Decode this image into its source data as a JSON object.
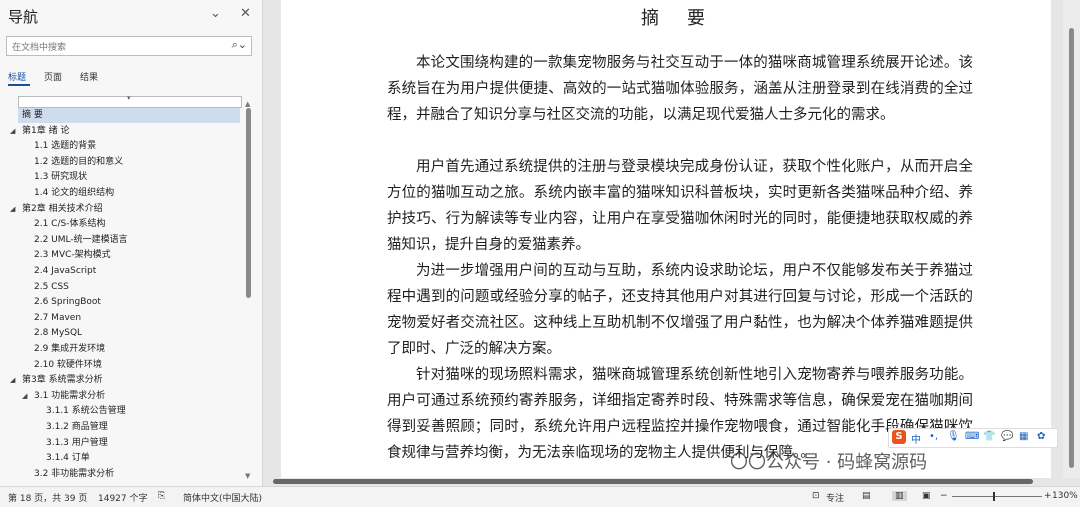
{
  "nav": {
    "title": "导航",
    "search_placeholder": "在文档中搜索",
    "tabs": [
      {
        "label": "标题",
        "active": true
      },
      {
        "label": "页面",
        "active": false
      },
      {
        "label": "结果",
        "active": false
      }
    ],
    "tree": [
      {
        "label": "摘  要",
        "level": 0,
        "selected": true
      },
      {
        "label": "第1章  绪  论",
        "level": 0,
        "expanded": true
      },
      {
        "label": "1.1  选题的背景",
        "level": 1
      },
      {
        "label": "1.2  选题的目的和意义",
        "level": 1
      },
      {
        "label": "1.3  研究现状",
        "level": 1
      },
      {
        "label": "1.4  论文的组织结构",
        "level": 1
      },
      {
        "label": "第2章  相关技术介绍",
        "level": 0,
        "expanded": true
      },
      {
        "label": "2.1  C/S-体系结构",
        "level": 1
      },
      {
        "label": "2.2  UML-统一建模语言",
        "level": 1
      },
      {
        "label": "2.3  MVC-架构模式",
        "level": 1
      },
      {
        "label": "2.4  JavaScript",
        "level": 1
      },
      {
        "label": "2.5  CSS",
        "level": 1
      },
      {
        "label": "2.6 SpringBoot",
        "level": 1
      },
      {
        "label": "2.7  Maven",
        "level": 1
      },
      {
        "label": "2.8  MySQL",
        "level": 1
      },
      {
        "label": "2.9  集成开发环境",
        "level": 1
      },
      {
        "label": "2.10  软硬件环境",
        "level": 1
      },
      {
        "label": "第3章  系统需求分析",
        "level": 0,
        "expanded": true
      },
      {
        "label": "3.1  功能需求分析",
        "level": 1,
        "expanded": true
      },
      {
        "label": "3.1.1  系统公告管理",
        "level": 2
      },
      {
        "label": "3.1.2  商品管理",
        "level": 2
      },
      {
        "label": "3.1.3  用户管理",
        "level": 2
      },
      {
        "label": "3.1.4  订单",
        "level": 2
      },
      {
        "label": "3.2  非功能需求分析",
        "level": 1
      }
    ]
  },
  "document": {
    "title": "摘要",
    "paragraphs": [
      "本论文围绕构建的一款集宠物服务与社交互动于一体的猫咪商城管理系统展开论述。该系统旨在为用户提供便捷、高效的一站式猫咖体验服务，涵盖从注册登录到在线消费的全过程，并融合了知识分享与社区交流的功能，以满足现代爱猫人士多元化的需求。",
      "用户首先通过系统提供的注册与登录模块完成身份认证，获取个性化账户，从而开启全方位的猫咖互动之旅。系统内嵌丰富的猫咪知识科普板块，实时更新各类猫咪品种介绍、养护技巧、行为解读等专业内容，让用户在享受猫咖休闲时光的同时，能便捷地获取权威的养猫知识，提升自身的爱猫素养。",
      "为进一步增强用户间的互动与互助，系统内设求助论坛，用户不仅能够发布关于养猫过程中遇到的问题或经验分享的帖子，还支持其他用户对其进行回复与讨论，形成一个活跃的宠物爱好者交流社区。这种线上互助机制不仅增强了用户黏性，也为解决个体养猫难题提供了即时、广泛的解决方案。",
      "针对猫咪的现场照料需求，猫咪商城管理系统创新性地引入宠物寄养与喂养服务功能。用户可通过系统预约寄养服务，详细指定寄养时段、特殊需求等信息，确保爱宠在猫咖期间得到妥善照顾；同时，系统允许用户远程监控并操作宠物喂食，通过智能化手段确保猫咪饮食规律与营养均衡，为无法亲临现场的宠物主人提供便利与保障。。"
    ]
  },
  "ime": {
    "label": "中"
  },
  "watermark": {
    "text": "公众号 · 码蜂窝源码"
  },
  "status": {
    "page": "第 18 页，共 39 页",
    "words": "14927 个字",
    "language": "简体中文(中国大陆)",
    "focus": "专注",
    "zoom": "130%"
  },
  "colors": {
    "accent": "#1b4f9c",
    "selection": "#cfdcee",
    "ime_logo": "#e8541e"
  }
}
